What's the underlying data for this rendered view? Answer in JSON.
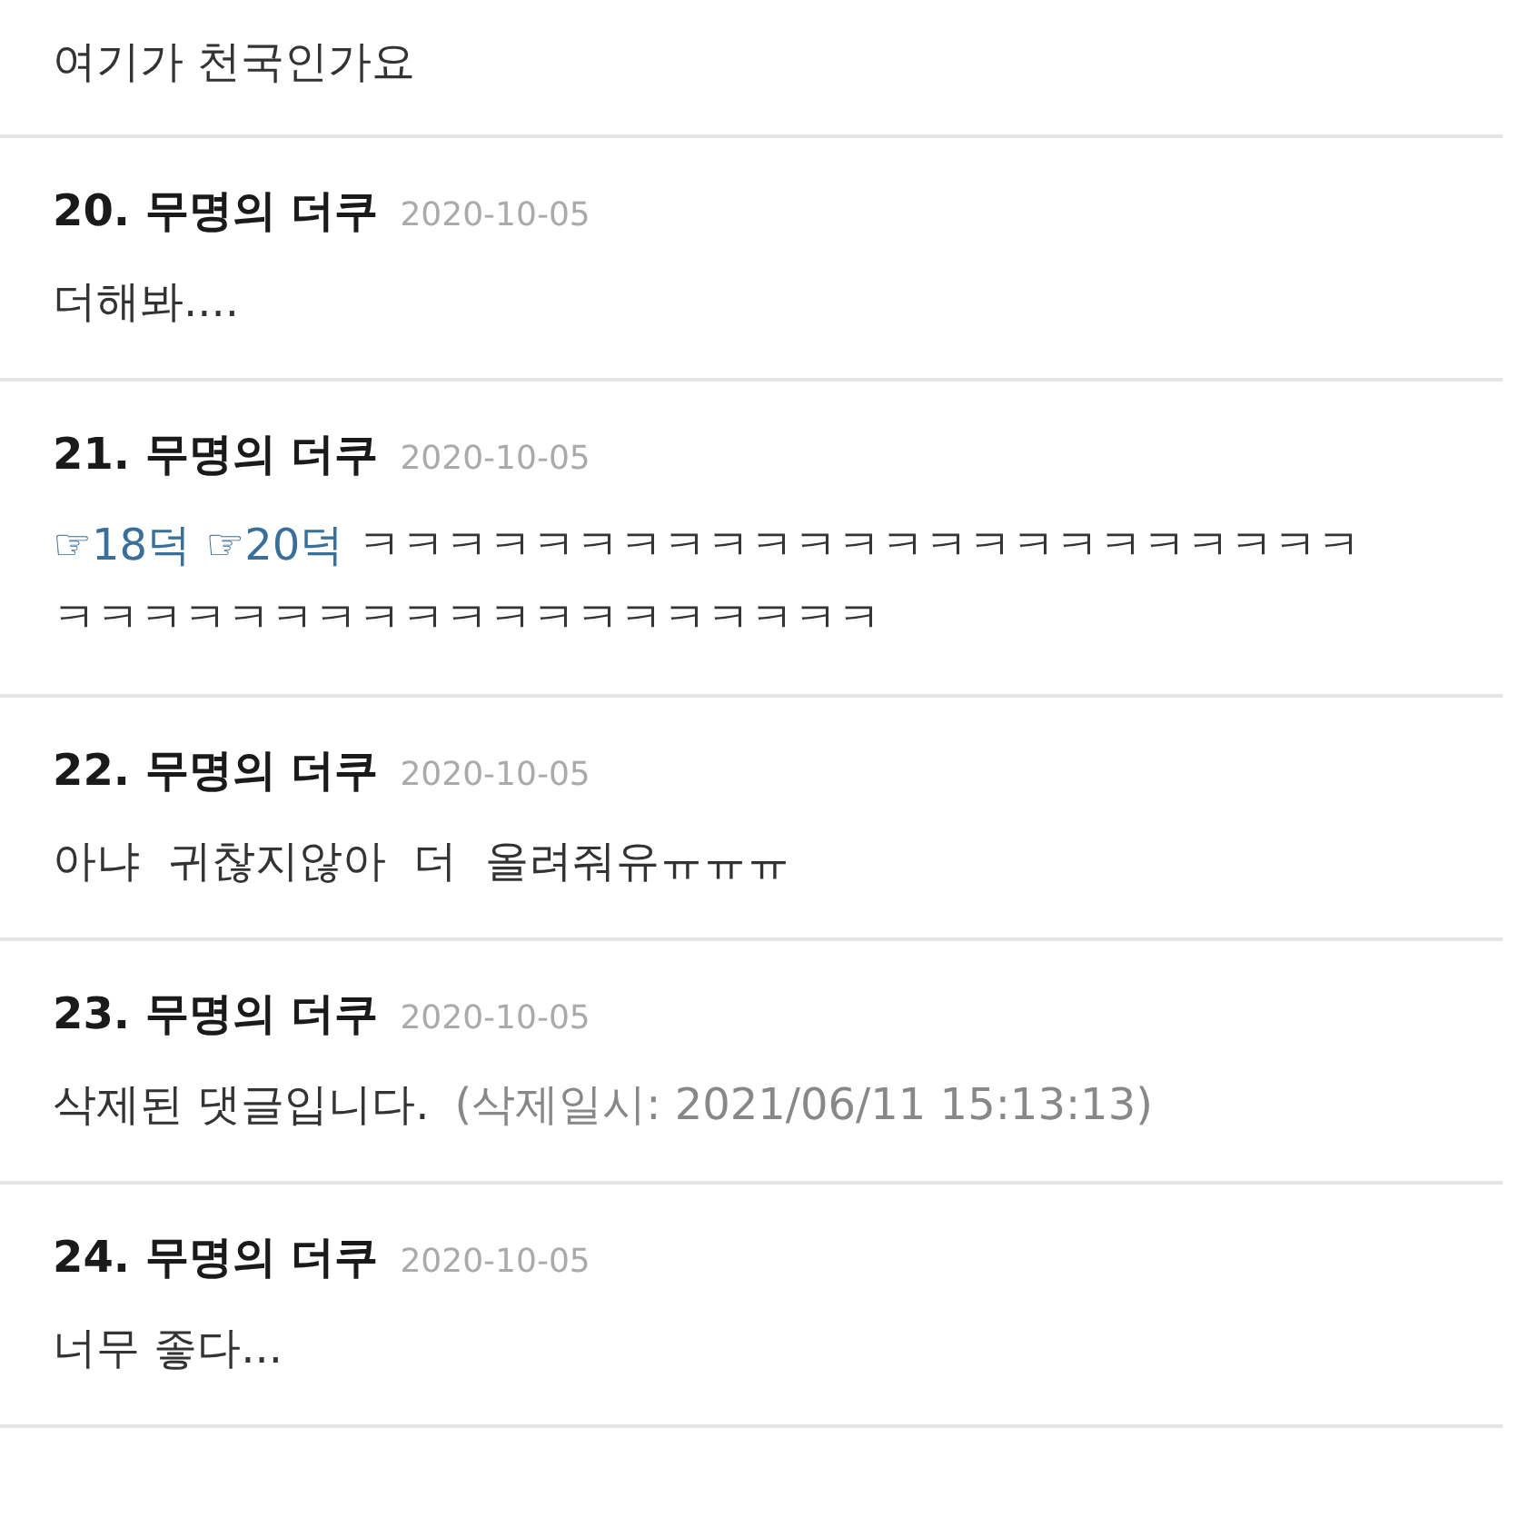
{
  "partial_comment": {
    "body": [
      {
        "kind": "text",
        "text": "여기가 천국인가요"
      }
    ]
  },
  "comments": [
    {
      "number": "20.",
      "author": "무명의 더쿠",
      "date": "2020-10-05",
      "body": [
        {
          "kind": "text",
          "text": "더해봐...."
        }
      ]
    },
    {
      "number": "21.",
      "author": "무명의 더쿠",
      "date": "2020-10-05",
      "body": [
        {
          "kind": "link",
          "text": "☞18덕"
        },
        {
          "kind": "link",
          "text": "☞20덕"
        },
        {
          "kind": "text",
          "text": "ㅋㅋㅋㅋㅋㅋㅋㅋㅋㅋㅋㅋㅋㅋㅋㅋㅋㅋㅋㅋㅋㅋㅋ"
        },
        {
          "kind": "text",
          "text": "ㅋㅋㅋㅋㅋㅋㅋㅋㅋㅋㅋㅋㅋㅋㅋㅋㅋㅋㅋ"
        }
      ]
    },
    {
      "number": "22.",
      "author": "무명의 더쿠",
      "date": "2020-10-05",
      "body": [
        {
          "kind": "text",
          "text": "아냐  귀찮지않아  더  올려줘유ㅠㅠㅠ"
        }
      ]
    },
    {
      "number": "23.",
      "author": "무명의 더쿠",
      "date": "2020-10-05",
      "body": [
        {
          "kind": "text",
          "text": "삭제된 댓글입니다."
        },
        {
          "kind": "note",
          "text": "(삭제일시: 2021/06/11 15:13:13)"
        }
      ]
    },
    {
      "number": "24.",
      "author": "무명의 더쿠",
      "date": "2020-10-05",
      "body": [
        {
          "kind": "text",
          "text": "너무 좋다..."
        }
      ]
    }
  ]
}
